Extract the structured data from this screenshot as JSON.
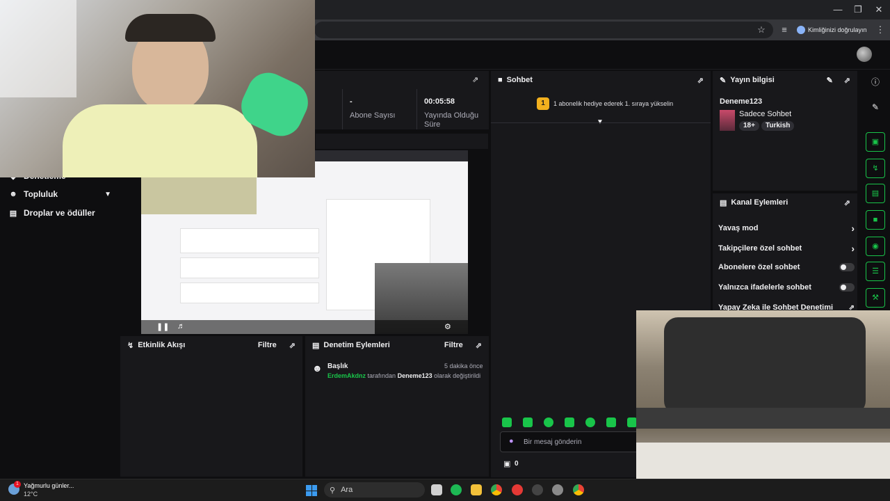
{
  "browser": {
    "profile_label": "Kimliğinizi doğrulayın"
  },
  "sidebar": {
    "items": [
      {
        "label": "Denetleme"
      },
      {
        "label": "Topluluk"
      },
      {
        "label": "Droplar ve ödüller"
      }
    ]
  },
  "stats": {
    "subs_value": "-",
    "subs_label": "Abone Sayısı",
    "live_value": "00:05:58",
    "live_label_1": "Yayında Olduğu",
    "live_label_2": "Süre"
  },
  "activity": {
    "title": "Etkinlik Akışı",
    "filter": "Filtre"
  },
  "modlog": {
    "title": "Denetim Eylemleri",
    "filter": "Filtre",
    "entry": {
      "heading": "Başlık",
      "time": "5 dakika önce",
      "user": "ErdemAkdnz",
      "mid": "tarafından",
      "value": "Deneme123",
      "tail": "olarak değiştirildi"
    }
  },
  "chat": {
    "title": "Sohbet",
    "rank_number": "1",
    "promo": "1 abonelik hediye ederek 1. sıraya yükselin",
    "input_placeholder": "Bir mesaj gönderin",
    "points": "0"
  },
  "stream_info": {
    "title": "Yayın bilgisi",
    "stream_title": "Deneme123",
    "category": "Sadece Sohbet",
    "tags": [
      "18+",
      "Turkish"
    ]
  },
  "channel_actions": {
    "title": "Kanal Eylemleri",
    "rows": [
      {
        "label": "Yavaş mod"
      },
      {
        "label": "Takipçilere özel sohbet"
      },
      {
        "label": "Abonelere özel sohbet"
      },
      {
        "label": "Yalnızca ifadelerle sohbet"
      },
      {
        "label": "Yapay Zeka ile Sohbet Denetimi"
      }
    ]
  },
  "taskbar": {
    "weather_title": "Yağmurlu günler...",
    "weather_temp": "12°C",
    "weather_badge": "1",
    "search_placeholder": "Ara"
  },
  "colors": {
    "accent_green": "#19c54a",
    "twitch_bg": "#0e0e10",
    "panel_bg": "#18181b",
    "rank_gold": "#f2b01e"
  }
}
